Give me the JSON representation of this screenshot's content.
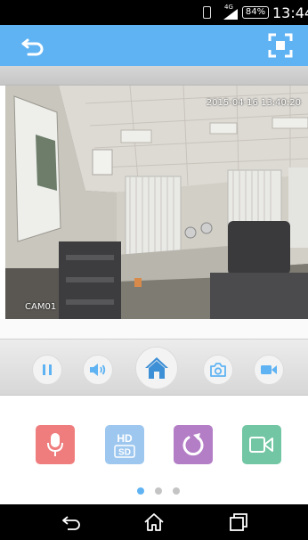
{
  "status_bar": {
    "network": "4G",
    "battery": "84%",
    "time": "13:44"
  },
  "action_bar": {
    "back_icon": "back-arrow-icon",
    "fullscreen_icon": "fullscreen-icon",
    "color": "#5fb3f3"
  },
  "video": {
    "timestamp": "2015-04-16 13:40:20",
    "camera_label": "CAM01"
  },
  "controls": [
    {
      "name": "pause",
      "icon": "pause-icon"
    },
    {
      "name": "volume",
      "icon": "speaker-icon"
    },
    {
      "name": "home",
      "icon": "home-icon"
    },
    {
      "name": "snapshot",
      "icon": "camera-icon"
    },
    {
      "name": "record",
      "icon": "video-camera-icon"
    }
  ],
  "tools": {
    "talk": {
      "icon": "microphone-icon",
      "color": "#ef7d7d"
    },
    "quality": {
      "icon": "hd-sd-icon",
      "top": "HD",
      "bottom": "SD",
      "color": "#9dc7ef"
    },
    "rotate": {
      "icon": "rotate-icon",
      "color": "#b37ec6"
    },
    "record": {
      "icon": "video-record-icon",
      "color": "#72c6a3"
    }
  },
  "pager": {
    "count": 3,
    "active": 0,
    "active_color": "#5fb3f3"
  },
  "nav_bar": [
    "back-icon",
    "home-icon",
    "recents-icon"
  ]
}
